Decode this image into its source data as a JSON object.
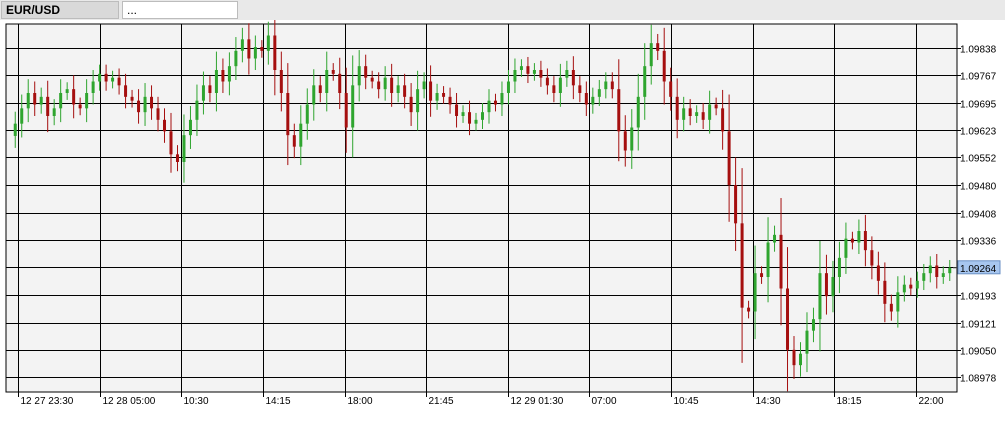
{
  "tabs": [
    {
      "label": "EUR/USD",
      "active": true
    },
    {
      "label": "...",
      "active": false
    }
  ],
  "chart_data": {
    "type": "candlestick",
    "symbol": "EUR/USD",
    "x_tick_labels": [
      "12 27 23:30",
      "12 28 05:00",
      "10:30",
      "14:15",
      "18:00",
      "21:45",
      "12 29 01:30",
      "07:00",
      "10:45",
      "14:30",
      "18:15",
      "22:00"
    ],
    "y_tick_labels": [
      "1.09838",
      "1.09767",
      "1.09695",
      "1.09623",
      "1.09552",
      "1.09480",
      "1.09408",
      "1.09336",
      "1.09265",
      "1.09193",
      "1.09121",
      "1.09050",
      "1.08978"
    ],
    "ylim": [
      1.0894,
      1.099
    ],
    "current_price": "1.09264",
    "grid": true,
    "colors": {
      "up": "#2fa52f",
      "down": "#a50f0f",
      "price_label_bg": "#a7c6ef",
      "plot_bg": "#f3f3f3",
      "grid": "#000000"
    },
    "prices": [
      1.09608,
      1.0964,
      1.0968,
      1.0972,
      1.0969,
      1.0971,
      1.0966,
      1.0968,
      1.0972,
      1.0973,
      1.0969,
      1.0968,
      1.0972,
      1.0975,
      1.0977,
      1.0975,
      1.0976,
      1.0974,
      1.0971,
      1.097,
      1.0967,
      1.0971,
      1.0968,
      1.0965,
      1.0962,
      1.0956,
      1.0954,
      1.0961,
      1.0965,
      1.097,
      1.0974,
      1.0972,
      1.0978,
      1.0975,
      1.0979,
      1.0983,
      1.0986,
      1.0981,
      1.0984,
      1.0983,
      1.0987,
      1.0978,
      1.0972,
      1.0961,
      1.0958,
      1.0964,
      1.0969,
      1.0974,
      1.0972,
      1.0978,
      1.0977,
      1.0972,
      1.0963,
      1.0974,
      1.0979,
      1.0976,
      1.0975,
      1.0973,
      1.0976,
      1.0972,
      1.0974,
      1.0971,
      1.0967,
      1.0973,
      1.0975,
      1.097,
      1.0972,
      1.0971,
      1.0969,
      1.0966,
      1.0967,
      1.0964,
      1.0965,
      1.0967,
      1.097,
      1.0969,
      1.0972,
      1.0975,
      1.0978,
      1.0979,
      1.0977,
      1.0978,
      1.0976,
      1.0974,
      1.0972,
      1.0976,
      1.0978,
      1.0974,
      1.0972,
      1.0969,
      1.0971,
      1.0973,
      1.0975,
      1.0973,
      1.0962,
      1.0957,
      1.0963,
      1.0971,
      1.0979,
      1.0985,
      1.0983,
      1.0975,
      1.0971,
      1.0965,
      1.0968,
      1.0966,
      1.0967,
      1.0965,
      1.0969,
      1.0968,
      1.0962,
      1.0948,
      1.0938,
      1.0916,
      1.0915,
      1.0925,
      1.0924,
      1.0933,
      1.0935,
      1.0921,
      1.0905,
      1.0901,
      1.0904,
      1.091,
      1.0913,
      1.0925,
      1.0919,
      1.0924,
      1.0929,
      1.0934,
      1.0933,
      1.0936,
      1.0931,
      1.0927,
      1.0923,
      1.0917,
      1.0915,
      1.092,
      1.0922,
      1.0921,
      1.0923,
      1.0925,
      1.0927,
      1.0924,
      1.0925,
      1.09264
    ]
  }
}
